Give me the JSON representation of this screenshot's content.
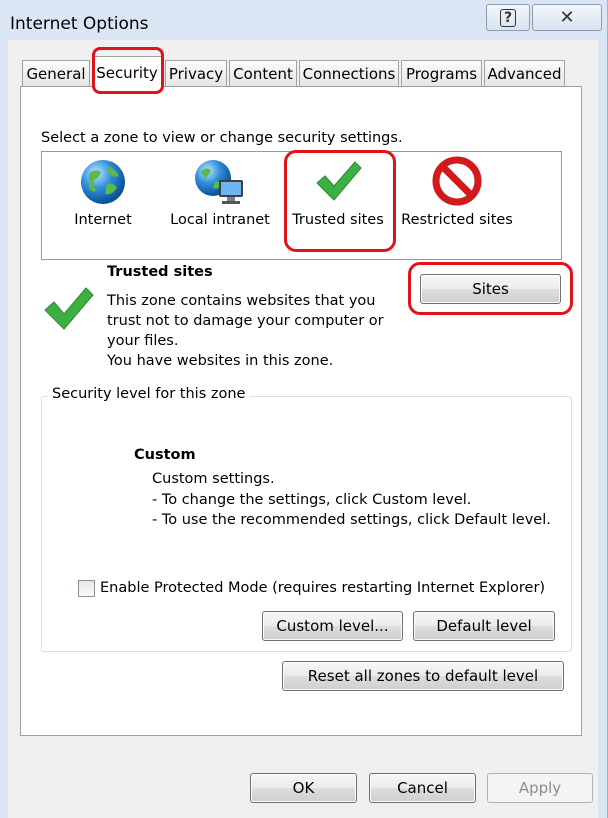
{
  "window": {
    "title": "Internet Options",
    "help_glyph": "?",
    "close_glyph": "✕"
  },
  "tabs": [
    {
      "label": "General",
      "active": false
    },
    {
      "label": "Security",
      "active": true
    },
    {
      "label": "Privacy",
      "active": false
    },
    {
      "label": "Content",
      "active": false
    },
    {
      "label": "Connections",
      "active": false
    },
    {
      "label": "Programs",
      "active": false
    },
    {
      "label": "Advanced",
      "active": false
    }
  ],
  "security": {
    "zone_prompt": "Select a zone to view or change security settings.",
    "zones": [
      {
        "label": "Internet",
        "icon": "globe-icon"
      },
      {
        "label": "Local intranet",
        "icon": "intranet-icon"
      },
      {
        "label": "Trusted sites",
        "icon": "green-check-icon",
        "selected": true
      },
      {
        "label": "Restricted sites",
        "icon": "no-entry-icon"
      }
    ],
    "selected_zone": {
      "title": "Trusted sites",
      "description": [
        "This zone contains websites that you",
        "trust not to damage your computer or",
        "your files.",
        "You have websites in this zone."
      ],
      "sites_button": "Sites"
    },
    "level": {
      "group_label": "Security level for this zone",
      "title": "Custom",
      "lines": [
        "Custom settings.",
        "- To change the settings, click Custom level.",
        "- To use the recommended settings, click Default level."
      ],
      "protected_mode_label": "Enable Protected Mode (requires restarting Internet Explorer)",
      "protected_mode_checked": false,
      "custom_level_button": "Custom level...",
      "default_level_button": "Default level"
    },
    "reset_all_button": "Reset all zones to default level"
  },
  "footer": {
    "ok": "OK",
    "cancel": "Cancel",
    "apply": "Apply"
  },
  "colors": {
    "highlight": "#e0131b",
    "check_green": "#3cb043",
    "no_entry_red": "#d21a1a"
  }
}
